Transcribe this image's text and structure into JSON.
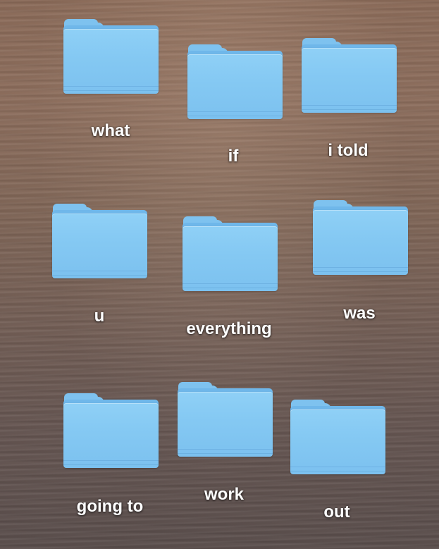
{
  "desktop": {
    "items": [
      {
        "label": "what",
        "icon": "folder-icon"
      },
      {
        "label": "if",
        "icon": "folder-icon"
      },
      {
        "label": "i told",
        "icon": "folder-icon"
      },
      {
        "label": "u",
        "icon": "folder-icon"
      },
      {
        "label": "everything",
        "icon": "folder-icon"
      },
      {
        "label": "was",
        "icon": "folder-icon"
      },
      {
        "label": "going to",
        "icon": "folder-icon"
      },
      {
        "label": "work",
        "icon": "folder-icon"
      },
      {
        "label": "out",
        "icon": "folder-icon"
      }
    ],
    "colors": {
      "folder": "#85c9f3",
      "label": "#ffffff"
    }
  }
}
